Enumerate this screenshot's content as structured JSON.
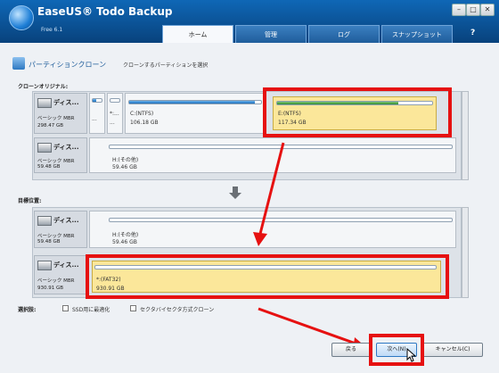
{
  "window": {
    "app_title": "EaseUS® Todo Backup",
    "edition": "Free 6.1",
    "controls": [
      "–",
      "□",
      "✕"
    ]
  },
  "tabs": [
    {
      "label": "ホーム",
      "active": true
    },
    {
      "label": "管理",
      "active": false
    },
    {
      "label": "ログ",
      "active": false
    },
    {
      "label": "スナップショット",
      "active": false
    }
  ],
  "help_label": "?",
  "page": {
    "title": "パーティションクローン",
    "subtitle": "クローンするパーティションを選択"
  },
  "source": {
    "label": "クローンオリジナル:",
    "disks": [
      {
        "name": "ディス...",
        "type": "ベーシック MBR",
        "size": "298.47 GB",
        "partitions": [
          {
            "label": "...",
            "size": "",
            "fill": 0.4,
            "bar_color": "blue"
          },
          {
            "label": "*:...",
            "size": "...",
            "fill": 0.0,
            "bar_color": "blue"
          },
          {
            "label": "C:(NTFS)",
            "size": "106.18 GB",
            "fill": 0.95,
            "bar_color": "blue"
          },
          {
            "label": "E:(NTFS)",
            "size": "117.34 GB",
            "fill": 0.78,
            "bar_color": "green",
            "selected": true
          }
        ]
      },
      {
        "name": "ディス...",
        "type": "ベーシック MBR",
        "size": "59.48 GB",
        "partitions": [
          {
            "label": "H:(その他)",
            "size": "59.46 GB",
            "fill": 0.0,
            "bar_color": "blue"
          }
        ]
      }
    ]
  },
  "target": {
    "label": "目標位置:",
    "disks": [
      {
        "name": "ディス...",
        "type": "ベーシック MBR",
        "size": "59.48 GB",
        "partitions": [
          {
            "label": "H:(その他)",
            "size": "59.46 GB",
            "fill": 0.0,
            "bar_color": "blue"
          }
        ]
      },
      {
        "name": "ディス...",
        "type": "ベーシック MBR",
        "size": "930.91 GB",
        "partitions": [
          {
            "label": "*:(FAT32)",
            "size": "930.91 GB",
            "fill": 0.0,
            "bar_color": "blue",
            "selected": true
          }
        ]
      }
    ]
  },
  "options": {
    "label": "選択肢:",
    "ssd_label": "SSD用に最適化",
    "sector_label": "セクタバイセクタ方式クローン"
  },
  "buttons": {
    "back": "戻る",
    "next": "次へ(N)",
    "cancel": "キャンセル(C)"
  },
  "colors": {
    "annotation": "#e61111",
    "selected_partition": "#fbe79a",
    "titlebar": "#0f67b6"
  }
}
